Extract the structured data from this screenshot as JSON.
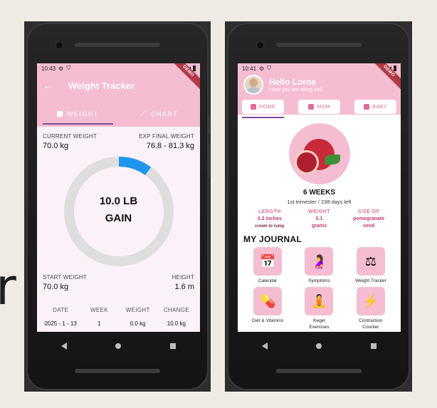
{
  "left_phone": {
    "status": {
      "time": "10:43"
    },
    "ribbon": "DEMO",
    "title": "Weight Tracker",
    "tabs": [
      {
        "label": "WEIGHT",
        "icon": "scale-icon",
        "active": true
      },
      {
        "label": "CHART",
        "icon": "trend-icon",
        "active": false
      }
    ],
    "current_weight_label": "CURRENT WEIGHT",
    "current_weight_value": "70.0 kg",
    "exp_final_label": "EXP FINAL WEIGHT",
    "exp_final_value": "76.8 - 81.3 kg",
    "gain_amount": "10.0 LB",
    "gain_label": "GAIN",
    "gain_progress_fraction": 0.1,
    "start_weight_label": "START WEIGHT",
    "start_weight_value": "70.0 kg",
    "height_label": "HEIGHT",
    "height_value": "1.6 m",
    "table": {
      "headers": [
        "DATE",
        "WEEK",
        "WEIGHT",
        "CHANGE"
      ],
      "rows": [
        [
          "2025 - 1 - 13",
          "1",
          "0.0 kg",
          "10.0 kg"
        ]
      ]
    }
  },
  "right_phone": {
    "status": {
      "time": "10:41"
    },
    "ribbon": "DEMO",
    "greeting": "Hello Lorna",
    "subtitle": "Hope you are doing well",
    "tabs": [
      {
        "label": "HOME",
        "active": true
      },
      {
        "label": "MOM",
        "active": false
      },
      {
        "label": "BABY",
        "active": false
      }
    ],
    "weeks": "6 WEEKS",
    "trimester": "1st trimester / 238 days left",
    "stats": [
      {
        "label": "LENGTH",
        "value1": "0.2 inches",
        "value2": "crown to rump"
      },
      {
        "label": "WEIGHT",
        "value1": "0.1",
        "value2": "grams"
      },
      {
        "label": "SIZE OF",
        "value1": "pomegranate",
        "value2": "seed"
      }
    ],
    "journal_title": "MY JOURNAL",
    "journal_items": [
      {
        "name": "Calendar",
        "icon": "calendar-icon"
      },
      {
        "name": "Symptoms",
        "icon": "pregnant-woman-icon"
      },
      {
        "name": "Weight Tracker",
        "icon": "scale-icon"
      },
      {
        "name": "Diet & Vitamins",
        "icon": "vitamins-icon"
      },
      {
        "name": "Kegel Exercises",
        "icon": "yoga-icon"
      },
      {
        "name": "Contraction Counter",
        "icon": "lightning-icon"
      }
    ]
  },
  "background_letter": "r",
  "colors": {
    "header_pink": "#f5bdd2",
    "accent_pink": "#e06b96",
    "progress_blue": "#1e96ee",
    "ribbon": "#b03a48"
  }
}
